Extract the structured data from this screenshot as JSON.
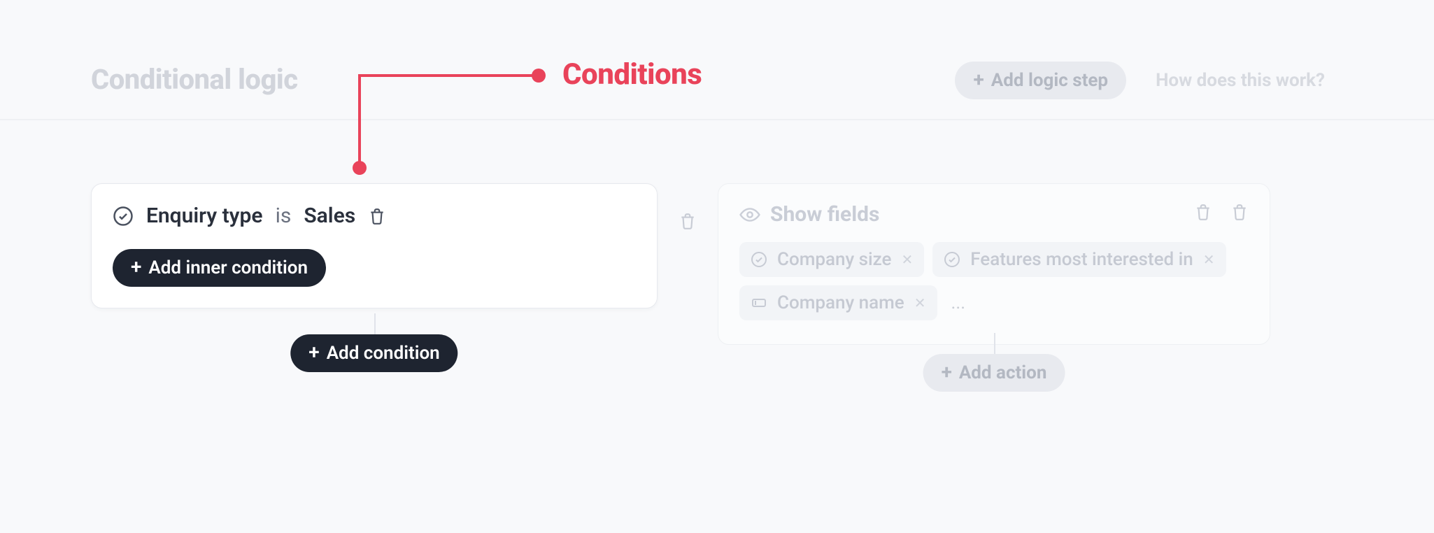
{
  "colors": {
    "accent": "#E9435A",
    "dark": "#1E2430"
  },
  "annotation": {
    "label": "Conditions"
  },
  "header": {
    "title": "Conditional logic",
    "add_step_label": "Add logic step",
    "help_label": "How does this work?"
  },
  "conditions": {
    "rows": [
      {
        "field": "Enquiry type",
        "op": "is",
        "value": "Sales"
      }
    ],
    "add_inner_label": "Add inner condition",
    "add_label": "Add condition"
  },
  "actions": {
    "title": "Show fields",
    "tags": [
      {
        "icon": "check",
        "label": "Company size"
      },
      {
        "icon": "check",
        "label": "Features most interested in"
      },
      {
        "icon": "field",
        "label": "Company name"
      }
    ],
    "ellipsis": "...",
    "add_label": "Add action"
  }
}
